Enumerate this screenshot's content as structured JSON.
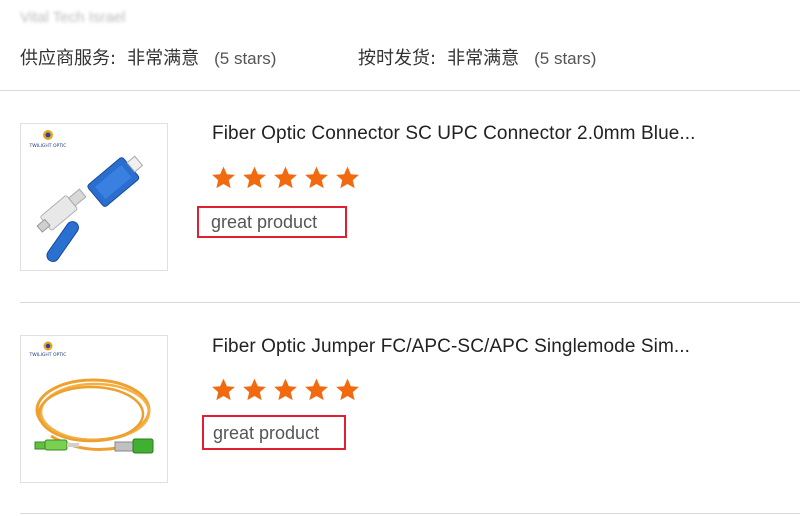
{
  "reviewer": {
    "text": "Vital Tech Israel"
  },
  "ratings": [
    {
      "label": "供应商服务:",
      "value": "非常满意",
      "stars_text": "(5 stars)"
    },
    {
      "label": "按时发货:",
      "value": "非常满意",
      "stars_text": "(5 stars)"
    }
  ],
  "items": [
    {
      "title": "Fiber Optic Connector SC UPC Connector 2.0mm Blue...",
      "rating": 5,
      "comment": "great product",
      "thumbnail": {
        "brand_text": "TWILIGHT OPTIC",
        "depicts": "blue SC UPC connector"
      }
    },
    {
      "title": "Fiber Optic Jumper FC/APC-SC/APC Singlemode Sim...",
      "rating": 5,
      "comment": "great product",
      "thumbnail": {
        "brand_text": "TWILIGHT OPTIC",
        "depicts": "yellow fiber patch cord"
      }
    }
  ],
  "colors": {
    "star": "#f26a10",
    "highlight_border": "#e02030",
    "divider": "#d9d9d9"
  }
}
